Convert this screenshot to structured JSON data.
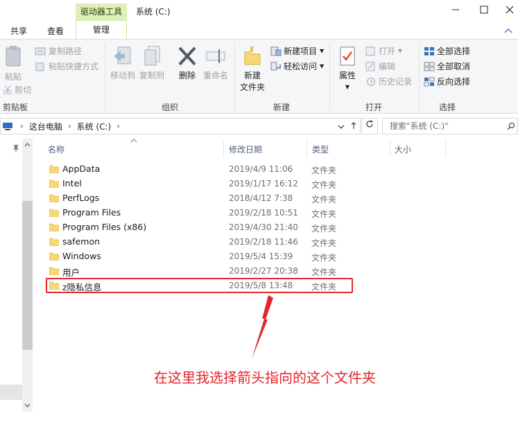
{
  "window": {
    "context_tab": "驱动器工具",
    "context_subtab": "管理",
    "title": "系统 (C:)",
    "tabs": [
      "共享",
      "查看"
    ]
  },
  "ribbon": {
    "clipboard": {
      "paste": "粘贴",
      "copy_path": "复制路径",
      "paste_shortcut": "粘贴快捷方式",
      "cut": "剪切",
      "group": "剪贴板"
    },
    "organize": {
      "move_to": "移动到",
      "copy_to": "复制到",
      "delete": "删除",
      "rename": "重命名",
      "group": "组织"
    },
    "new": {
      "new_folder": "新建\n文件夹",
      "new_folder_l1": "新建",
      "new_folder_l2": "文件夹",
      "new_item": "新建项目",
      "easy_access": "轻松访问",
      "group": "新建"
    },
    "open": {
      "properties": "属性",
      "open": "打开",
      "edit": "编辑",
      "history": "历史记录",
      "group": "打开"
    },
    "select": {
      "select_all": "全部选择",
      "select_none": "全部取消",
      "invert": "反向选择",
      "group": "选择"
    }
  },
  "address": {
    "crumbs": [
      "这台电脑",
      "系统 (C:)"
    ],
    "search_placeholder": "搜索\"系统 (C:)\""
  },
  "columns": {
    "name": "名称",
    "date": "修改日期",
    "type": "类型",
    "size": "大小"
  },
  "files": [
    {
      "name": "AppData",
      "date": "2019/4/9 11:06",
      "type": "文件夹"
    },
    {
      "name": "Intel",
      "date": "2019/1/17 16:12",
      "type": "文件夹"
    },
    {
      "name": "PerfLogs",
      "date": "2018/4/12 7:38",
      "type": "文件夹"
    },
    {
      "name": "Program Files",
      "date": "2019/2/18 10:51",
      "type": "文件夹"
    },
    {
      "name": "Program Files (x86)",
      "date": "2019/4/30 21:40",
      "type": "文件夹"
    },
    {
      "name": "safemon",
      "date": "2019/2/18 11:46",
      "type": "文件夹"
    },
    {
      "name": "Windows",
      "date": "2019/5/4 15:39",
      "type": "文件夹"
    },
    {
      "name": "用户",
      "date": "2019/2/27 20:38",
      "type": "文件夹"
    },
    {
      "name": "z隐私信息",
      "date": "2019/5/8 13:48",
      "type": "文件夹"
    }
  ],
  "annotation": "在这里我选择箭头指向的这个文件夹",
  "colors": {
    "annotation_red": "#e3262d",
    "context_tab_green": "#ddf0b8",
    "folder_yellow": "#f8d775"
  }
}
